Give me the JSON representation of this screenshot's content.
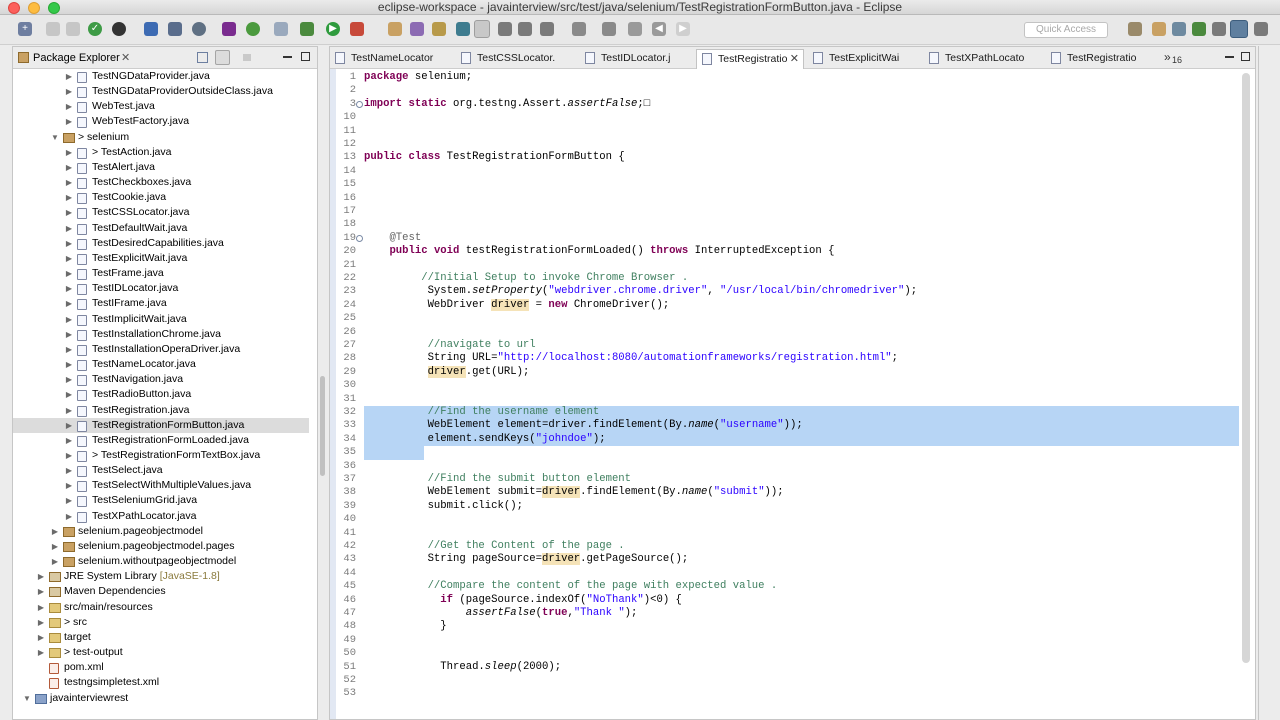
{
  "window": {
    "title": "eclipse-workspace - javainterview/src/test/java/selenium/TestRegistrationFormButton.java - Eclipse"
  },
  "toolbar": {
    "quick_access_placeholder": "Quick Access"
  },
  "package_explorer": {
    "title": "Package Explorer",
    "items": [
      {
        "label": "TestNGDataProvider.java",
        "indent": 3,
        "type": "file",
        "arrow": "▶"
      },
      {
        "label": "TestNGDataProviderOutsideClass.java",
        "indent": 3,
        "type": "file",
        "arrow": "▶"
      },
      {
        "label": "WebTest.java",
        "indent": 3,
        "type": "file",
        "arrow": "▶"
      },
      {
        "label": "WebTestFactory.java",
        "indent": 3,
        "type": "file",
        "arrow": "▶"
      },
      {
        "label": "> selenium",
        "indent": 2,
        "type": "package",
        "arrow": "▼"
      },
      {
        "label": "> TestAction.java",
        "indent": 3,
        "type": "file",
        "arrow": "▶"
      },
      {
        "label": "TestAlert.java",
        "indent": 3,
        "type": "file",
        "arrow": "▶"
      },
      {
        "label": "TestCheckboxes.java",
        "indent": 3,
        "type": "file",
        "arrow": "▶"
      },
      {
        "label": "TestCookie.java",
        "indent": 3,
        "type": "file",
        "arrow": "▶"
      },
      {
        "label": "TestCSSLocator.java",
        "indent": 3,
        "type": "file",
        "arrow": "▶"
      },
      {
        "label": "TestDefaultWait.java",
        "indent": 3,
        "type": "file",
        "arrow": "▶"
      },
      {
        "label": "TestDesiredCapabilities.java",
        "indent": 3,
        "type": "file",
        "arrow": "▶"
      },
      {
        "label": "TestExplicitWait.java",
        "indent": 3,
        "type": "file",
        "arrow": "▶"
      },
      {
        "label": "TestFrame.java",
        "indent": 3,
        "type": "file",
        "arrow": "▶"
      },
      {
        "label": "TestIDLocator.java",
        "indent": 3,
        "type": "file",
        "arrow": "▶"
      },
      {
        "label": "TestIFrame.java",
        "indent": 3,
        "type": "file",
        "arrow": "▶"
      },
      {
        "label": "TestImplicitWait.java",
        "indent": 3,
        "type": "file",
        "arrow": "▶"
      },
      {
        "label": "TestInstallationChrome.java",
        "indent": 3,
        "type": "file",
        "arrow": "▶"
      },
      {
        "label": "TestInstallationOperaDriver.java",
        "indent": 3,
        "type": "file",
        "arrow": "▶"
      },
      {
        "label": "TestNameLocator.java",
        "indent": 3,
        "type": "file",
        "arrow": "▶"
      },
      {
        "label": "TestNavigation.java",
        "indent": 3,
        "type": "file",
        "arrow": "▶"
      },
      {
        "label": "TestRadioButton.java",
        "indent": 3,
        "type": "file",
        "arrow": "▶"
      },
      {
        "label": "TestRegistration.java",
        "indent": 3,
        "type": "file",
        "arrow": "▶"
      },
      {
        "label": "TestRegistrationFormButton.java",
        "indent": 3,
        "type": "file",
        "arrow": "▶",
        "selected": true
      },
      {
        "label": "TestRegistrationFormLoaded.java",
        "indent": 3,
        "type": "file",
        "arrow": "▶"
      },
      {
        "label": "> TestRegistrationFormTextBox.java",
        "indent": 3,
        "type": "file",
        "arrow": "▶"
      },
      {
        "label": "TestSelect.java",
        "indent": 3,
        "type": "file",
        "arrow": "▶"
      },
      {
        "label": "TestSelectWithMultipleValues.java",
        "indent": 3,
        "type": "file",
        "arrow": "▶"
      },
      {
        "label": "TestSeleniumGrid.java",
        "indent": 3,
        "type": "file",
        "arrow": "▶"
      },
      {
        "label": "TestXPathLocator.java",
        "indent": 3,
        "type": "file",
        "arrow": "▶"
      },
      {
        "label": "selenium.pageobjectmodel",
        "indent": 2,
        "type": "package",
        "arrow": "▶"
      },
      {
        "label": "selenium.pageobjectmodel.pages",
        "indent": 2,
        "type": "package",
        "arrow": "▶"
      },
      {
        "label": "selenium.withoutpageobjectmodel",
        "indent": 2,
        "type": "package",
        "arrow": "▶"
      },
      {
        "label": "JRE System Library",
        "suffix": " [JavaSE-1.8]",
        "indent": 1,
        "type": "library",
        "arrow": "▶"
      },
      {
        "label": "Maven Dependencies",
        "indent": 1,
        "type": "library",
        "arrow": "▶"
      },
      {
        "label": "src/main/resources",
        "indent": 1,
        "type": "folder",
        "arrow": "▶"
      },
      {
        "label": "> src",
        "indent": 1,
        "type": "folder",
        "arrow": "▶"
      },
      {
        "label": "target",
        "indent": 1,
        "type": "folder",
        "arrow": "▶"
      },
      {
        "label": "> test-output",
        "indent": 1,
        "type": "folder",
        "arrow": "▶"
      },
      {
        "label": "pom.xml",
        "indent": 1,
        "type": "xml",
        "arrow": ""
      },
      {
        "label": "testngsimpletest.xml",
        "indent": 1,
        "type": "xml",
        "arrow": ""
      },
      {
        "label": "javainterviewrest",
        "indent": 0,
        "type": "project",
        "arrow": "▼"
      }
    ]
  },
  "editor": {
    "tabs": [
      {
        "label": "TestNameLocator",
        "active": false
      },
      {
        "label": "TestCSSLocator.",
        "active": false
      },
      {
        "label": "TestIDLocator.j",
        "active": false
      },
      {
        "label": "TestRegistratio",
        "active": true
      },
      {
        "label": "TestExplicitWai",
        "active": false
      },
      {
        "label": "TestXPathLocato",
        "active": false
      },
      {
        "label": "TestRegistratio",
        "active": false
      }
    ],
    "overflow_label": "»",
    "overflow_count": "16",
    "lines": [
      {
        "n": "1",
        "html": "<span class=\"kw\">package</span> selenium;"
      },
      {
        "n": "2",
        "html": ""
      },
      {
        "n": "3",
        "html": "<span class=\"kw\">import</span> <span class=\"kw\">static</span> org.testng.Assert.<span class=\"it\">assertFalse</span>;&#9633;"
      },
      {
        "n": "10",
        "html": ""
      },
      {
        "n": "11",
        "html": ""
      },
      {
        "n": "12",
        "html": ""
      },
      {
        "n": "13",
        "html": "<span class=\"kw\">public</span> <span class=\"kw\">class</span> TestRegistrationFormButton {"
      },
      {
        "n": "14",
        "html": ""
      },
      {
        "n": "15",
        "html": ""
      },
      {
        "n": "16",
        "html": ""
      },
      {
        "n": "17",
        "html": ""
      },
      {
        "n": "18",
        "html": ""
      },
      {
        "n": "19",
        "html": "    <span class=\"an\">@Test</span>"
      },
      {
        "n": "20",
        "html": "    <span class=\"kw\">public</span> <span class=\"kw\">void</span> testRegistrationFormLoaded() <span class=\"kw\">throws</span> InterruptedException {"
      },
      {
        "n": "21",
        "html": ""
      },
      {
        "n": "22",
        "html": "         <span class=\"cm\">//Initial Setup to invoke Chrome Browser .</span>"
      },
      {
        "n": "23",
        "html": "          System.<span class=\"it\">setProperty</span>(<span class=\"st\">\"webdriver.chrome.driver\"</span>, <span class=\"st\">\"/usr/local/bin/chromedriver\"</span>);"
      },
      {
        "n": "24",
        "html": "          WebDriver <span class=\"hl\">driver</span> = <span class=\"kw\">new</span> ChromeDriver();"
      },
      {
        "n": "25",
        "html": ""
      },
      {
        "n": "26",
        "html": ""
      },
      {
        "n": "27",
        "html": "          <span class=\"cm\">//navigate to url</span>"
      },
      {
        "n": "28",
        "html": "          String URL=<span class=\"st\">\"http://localhost:8080/automationframeworks/registration.html\"</span>;"
      },
      {
        "n": "29",
        "html": "          <span class=\"hl\">driver</span>.get(URL);"
      },
      {
        "n": "30",
        "html": ""
      },
      {
        "n": "31",
        "html": ""
      },
      {
        "n": "32",
        "html": "          <span class=\"cm\">//Find the username element</span>",
        "sel": true
      },
      {
        "n": "33",
        "html": "          WebElement element=driver.findElement(By.<span class=\"it\">name</span>(<span class=\"st\">\"username\"</span>));",
        "sel": true
      },
      {
        "n": "34",
        "html": "          element.sendKeys(<span class=\"st\">\"johndoe\"</span>);",
        "sel": true
      },
      {
        "n": "35",
        "html": "",
        "sel": true,
        "partial": true
      },
      {
        "n": "36",
        "html": ""
      },
      {
        "n": "37",
        "html": "          <span class=\"cm\">//Find the submit button element</span>"
      },
      {
        "n": "38",
        "html": "          WebElement submit=<span class=\"hl\">driver</span>.findElement(By.<span class=\"it\">name</span>(<span class=\"st\">\"submit\"</span>));"
      },
      {
        "n": "39",
        "html": "          submit.click();"
      },
      {
        "n": "40",
        "html": ""
      },
      {
        "n": "41",
        "html": ""
      },
      {
        "n": "42",
        "html": "          <span class=\"cm\">//Get the Content of the page .</span>"
      },
      {
        "n": "43",
        "html": "          String pageSource=<span class=\"hl\">driver</span>.getPageSource();"
      },
      {
        "n": "44",
        "html": ""
      },
      {
        "n": "45",
        "html": "          <span class=\"cm\">//Compare the content of the page with expected value .</span>"
      },
      {
        "n": "46",
        "html": "            <span class=\"kw\">if</span> (pageSource.indexOf(<span class=\"st\">\"NoThank\"</span>)&lt;0) {"
      },
      {
        "n": "47",
        "html": "                <span class=\"it\">assertFalse</span>(<span class=\"kw\">true</span>,<span class=\"st\">\"Thank \"</span>);"
      },
      {
        "n": "48",
        "html": "            }"
      },
      {
        "n": "49",
        "html": ""
      },
      {
        "n": "50",
        "html": ""
      },
      {
        "n": "51",
        "html": "            Thread.<span class=\"it\">sleep</span>(2000);"
      },
      {
        "n": "52",
        "html": ""
      },
      {
        "n": "53",
        "html": ""
      }
    ]
  }
}
